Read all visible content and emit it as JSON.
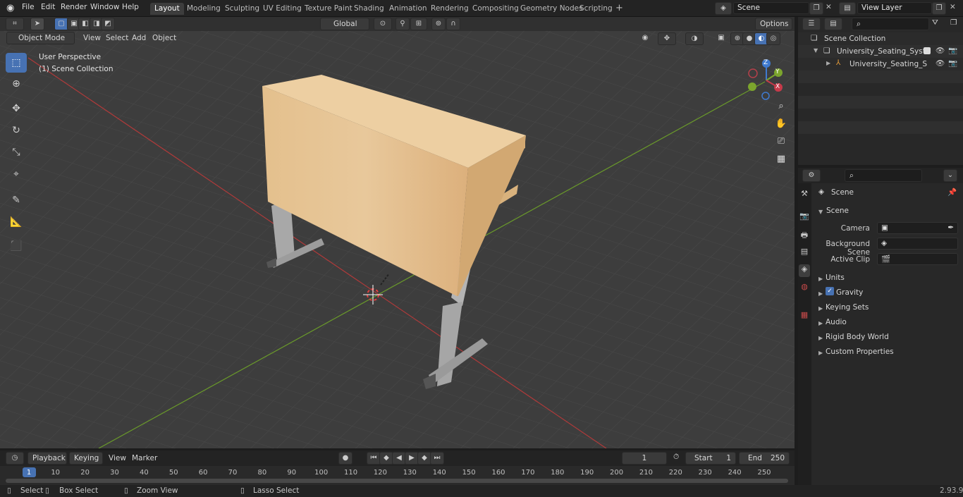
{
  "topbar": {
    "menus": [
      "File",
      "Edit",
      "Render",
      "Window",
      "Help"
    ],
    "workspaces": [
      "Layout",
      "Modeling",
      "Sculpting",
      "UV Editing",
      "Texture Paint",
      "Shading",
      "Animation",
      "Rendering",
      "Compositing",
      "Geometry Nodes",
      "Scripting"
    ],
    "add_tab": "+",
    "scene_name": "Scene",
    "view_layer_name": "View Layer"
  },
  "viewport_header": {
    "mode": "Object Mode",
    "menus": [
      "View",
      "Select",
      "Add",
      "Object"
    ],
    "orientation": "Global",
    "options": "Options"
  },
  "viewport": {
    "perspective_label": "User Perspective",
    "collection_label": "(1) Scene Collection",
    "gizmo": {
      "x": "X",
      "y": "Y",
      "z": "Z"
    }
  },
  "outliner": {
    "root": "Scene Collection",
    "items": [
      {
        "label": "University_Seating_System_T"
      },
      {
        "label": "University_Seating_Syste"
      }
    ]
  },
  "properties": {
    "context": "Scene",
    "panel": "Scene",
    "fields": [
      {
        "label": "Camera",
        "value": ""
      },
      {
        "label": "Background Scene",
        "value": ""
      },
      {
        "label": "Active Clip",
        "value": ""
      }
    ],
    "subpanels": [
      "Units",
      "Gravity",
      "Keying Sets",
      "Audio",
      "Rigid Body World",
      "Custom Properties"
    ],
    "gravity_checked": true
  },
  "timeline": {
    "menus": [
      "Playback",
      "Keying",
      "View",
      "Marker"
    ],
    "current_frame": "1",
    "start_label": "Start",
    "start": "1",
    "end_label": "End",
    "end": "250",
    "ticks": [
      "1",
      "10",
      "20",
      "30",
      "40",
      "50",
      "60",
      "70",
      "80",
      "90",
      "100",
      "110",
      "120",
      "130",
      "140",
      "150",
      "160",
      "170",
      "180",
      "190",
      "200",
      "210",
      "220",
      "230",
      "240",
      "250"
    ]
  },
  "statusbar": {
    "items": [
      "Select",
      "Box Select",
      "Zoom View",
      "Lasso Select"
    ],
    "version": "2.93.9"
  },
  "colors": {
    "accent": "#4772b3",
    "x_axis": "#b03a3a",
    "y_axis": "#6a9a2a",
    "wood": "#e6c393",
    "frame": "#a9a9a9"
  }
}
